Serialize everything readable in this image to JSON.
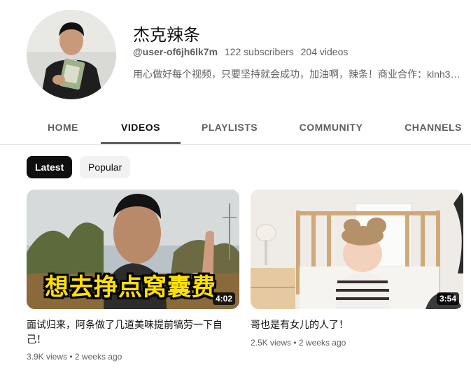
{
  "channel": {
    "name": "杰克辣条",
    "handle": "@user-of6jh6lk7m",
    "subscribers": "122 subscribers",
    "videos": "204 videos",
    "description": "用心做好每个视频，只要坚持就会成功，加油啊，辣条！商业合作：klnh33..."
  },
  "tabs": [
    "HOME",
    "VIDEOS",
    "PLAYLISTS",
    "COMMUNITY",
    "CHANNELS"
  ],
  "active_tab": "VIDEOS",
  "filters": {
    "latest": "Latest",
    "popular": "Popular",
    "selected": "Latest"
  },
  "videos": [
    {
      "title": "面试归来，阿条做了几道美味提前犒劳一下自己！",
      "overlay_text": "想去挣点窝囊费",
      "duration": "4:02",
      "views": "3.9K views",
      "age": "2 weeks ago"
    },
    {
      "title": "哥也是有女儿的人了！",
      "duration": "3:54",
      "views": "2.5K views",
      "age": "2 weeks ago"
    }
  ],
  "colors": {
    "text_primary": "#0f0f0f",
    "text_secondary": "#606060",
    "chip_selected_bg": "#0f0f0f",
    "chip_bg": "#f2f2f2",
    "overlay_text": "#ffe100"
  }
}
